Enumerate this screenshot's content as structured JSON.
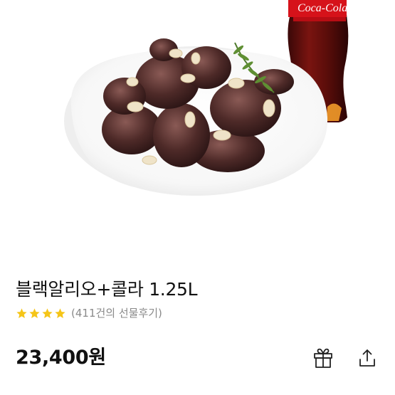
{
  "product": {
    "title": "블랙알리오+콜라 1.25L",
    "rating_stars": 4,
    "review_text": "(411건의 선물후기)",
    "price": "23,400원"
  },
  "hero_image": {
    "description_icon": "fried-chicken-and-cola-photo-icon",
    "bottle_label": "Coca-Cola"
  },
  "icons": {
    "gift": "gift-icon",
    "share": "share-icon",
    "star": "star-icon"
  },
  "colors": {
    "star": "#F5C518",
    "text": "#111111",
    "muted": "#8A8A8A"
  }
}
